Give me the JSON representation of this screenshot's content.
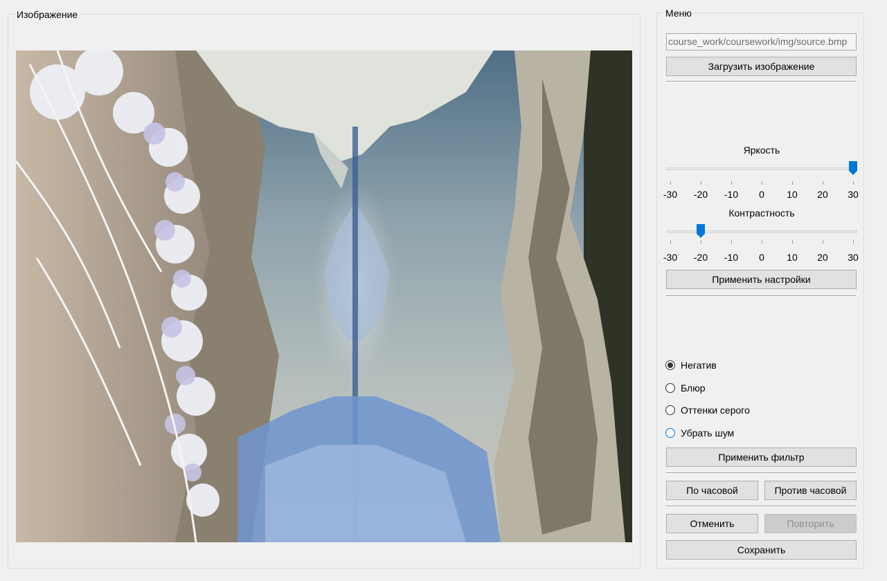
{
  "image_group": {
    "title": "Изображение"
  },
  "menu": {
    "title": "Меню",
    "path_value": "course_work/coursework/img/source.bmp",
    "load_button": "Загрузить изображение",
    "brightness": {
      "label": "Яркость",
      "value": 30,
      "min": -30,
      "max": 30,
      "tick_labels": [
        "-30",
        "-20",
        "-10",
        "0",
        "10",
        "20",
        "30"
      ]
    },
    "contrast": {
      "label": "Контрастность",
      "value": -20,
      "min": -30,
      "max": 30,
      "tick_labels": [
        "-30",
        "-20",
        "-10",
        "0",
        "10",
        "20",
        "30"
      ]
    },
    "apply_settings_button": "Применить настройки",
    "filters": [
      {
        "label": "Негатив",
        "checked": true
      },
      {
        "label": "Блюр",
        "checked": false
      },
      {
        "label": "Оттенки серого",
        "checked": false
      },
      {
        "label": "Убрать шум",
        "checked": false
      }
    ],
    "apply_filter_button": "Применить фильтр",
    "rotate_cw_button": "По часовой",
    "rotate_ccw_button": "Против часовой",
    "undo_button": "Отменить",
    "redo_button": "Повторить",
    "save_button": "Сохранить"
  },
  "colors": {
    "slider_thumb": "#0078d7",
    "window_bg": "#f0f0f0",
    "button_bg": "#e1e1e1"
  }
}
